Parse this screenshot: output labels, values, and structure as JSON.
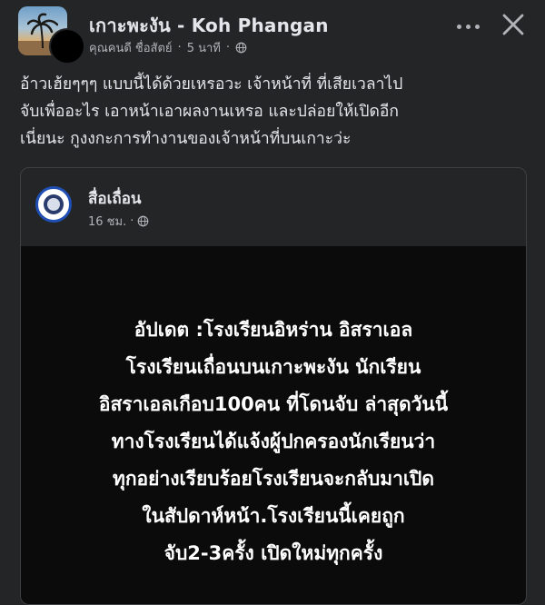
{
  "post": {
    "group_name": "เกาะพะงัน - Koh Phangan",
    "author": "คุณคนดี ชื่อสัตย์",
    "separator": "·",
    "time": "5 นาที",
    "privacy_icon": "globe-icon",
    "text_lines": [
      "อ้าวเฮ้ยๆๆๆ แบบนี้ได้ด้วยเหรอวะ เจ้าหน้าที่ ที่เสียเวลาไป",
      "จับเพื่ออะไร เอาหน้าเอาผลงานเหรอ และปล่อยให้เปิดอีก",
      "เนี่ยนะ กูงงกะการทำงานของเจ้าหน้าที่บนเกาะว่ะ"
    ]
  },
  "shared": {
    "page_name": "สื่อเถื่อน",
    "time": "16 ชม.",
    "separator": "·",
    "privacy_icon": "globe-icon",
    "image_text_lines": [
      "อัปเดต :โรงเรียนอิหร่าน อิสราเอล",
      "โรงเรียนเถื่อนบนเกาะพะงัน นักเรียน",
      "อิสราเอลเกือบ100คน ที่โดนจับ ล่าสุดวันนี้",
      "ทางโรงเรียนได้แจ้งผู้ปกครองนักเรียนว่า",
      "ทุกอย่างเรียบร้อยโรงเรียนจะกลับมาเปิด",
      "ในสัปดาห์หน้า.โรงเรียนนี้เคยถูก",
      "จับ2-3ครั้ง เปิดใหม่ทุกครั้ง"
    ]
  },
  "colors": {
    "background": "#242526",
    "primary_text": "#e4e6eb",
    "secondary_text": "#b0b3b8",
    "media_background": "#0b0b0b"
  }
}
